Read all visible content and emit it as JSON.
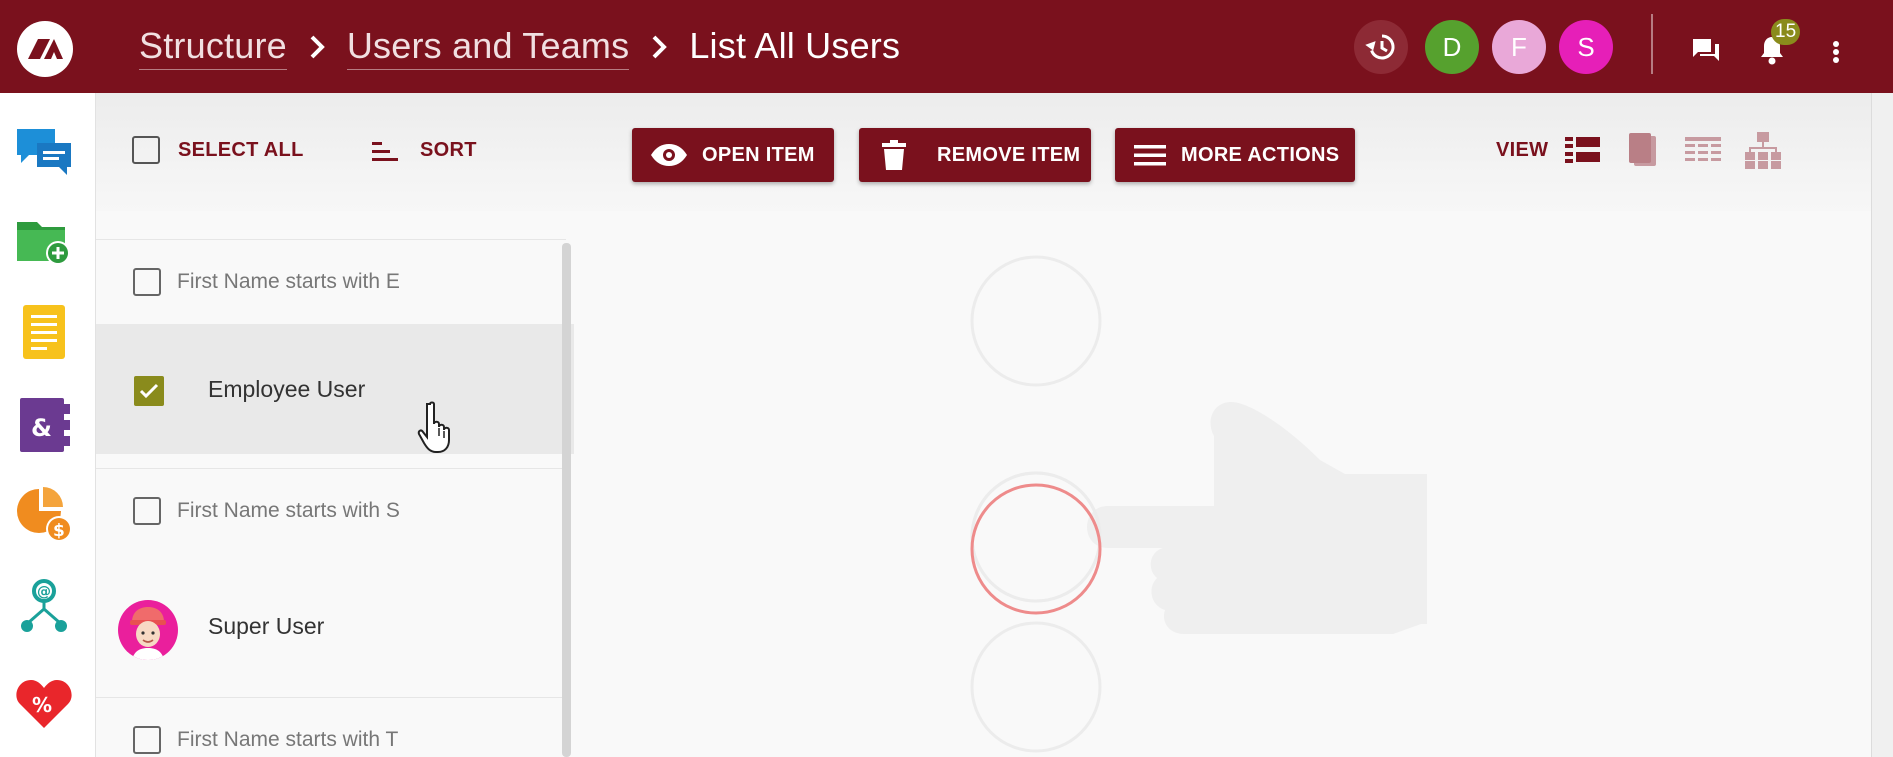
{
  "header": {
    "breadcrumb": [
      "Structure",
      "Users and Teams",
      "List All Users"
    ],
    "avatars": [
      {
        "initial": "D",
        "color": "#56a12e"
      },
      {
        "initial": "F",
        "color": "#e9a8d8"
      },
      {
        "initial": "S",
        "color": "#e61fb8"
      }
    ],
    "notification_count": "15"
  },
  "toolbar": {
    "select_all_label": "SELECT ALL",
    "sort_label": "SORT",
    "open_item_label": "OPEN ITEM",
    "remove_item_label": "REMOVE ITEM",
    "more_actions_label": "MORE ACTIONS",
    "view_label": "VIEW"
  },
  "list": {
    "groups": [
      {
        "label": "First Name starts with E"
      },
      {
        "label": "First Name starts with S"
      },
      {
        "label": "First Name starts with T"
      }
    ],
    "items": [
      {
        "name": "Employee User",
        "checked": true
      },
      {
        "name": "Super User",
        "checked": false
      }
    ]
  },
  "colors": {
    "brand": "#7a111d",
    "check": "#8a8b1c"
  }
}
